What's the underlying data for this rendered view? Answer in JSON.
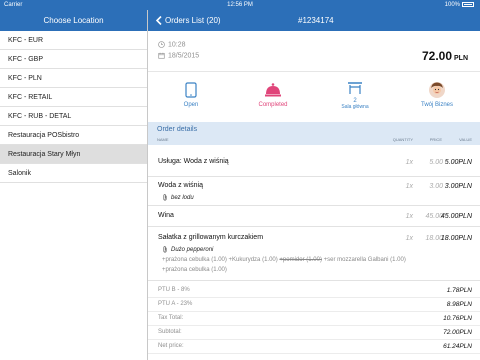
{
  "status_bar": {
    "carrier": "Carrier",
    "time": "12:56 PM",
    "battery": "100%",
    "battery_level": 1.0
  },
  "sidebar": {
    "title": "Choose Location",
    "items": [
      {
        "label": "KFC - EUR"
      },
      {
        "label": "KFC - GBP"
      },
      {
        "label": "KFC - PLN"
      },
      {
        "label": "KFC - RETAIL"
      },
      {
        "label": "KFC - RUB - DETAL"
      },
      {
        "label": "Restauracja POSbistro"
      },
      {
        "label": "Restauracja Stary Młyn"
      },
      {
        "label": "Salonik"
      }
    ]
  },
  "header": {
    "back_label": "Orders List (20)",
    "order_number": "#1234174"
  },
  "order": {
    "time": "10:28",
    "date": "18/5/2015",
    "total": "72.00",
    "currency": "PLN"
  },
  "statuses": [
    {
      "label": "Open",
      "icon": "tablet-icon"
    },
    {
      "label": "Completed",
      "icon": "service-bell-icon"
    },
    {
      "label": "Sala główna",
      "badge": "2",
      "icon": "table-icon"
    },
    {
      "label": "Twój Biznes",
      "icon": "person-avatar-icon"
    }
  ],
  "details": {
    "title": "Order details",
    "col_name": "NAME",
    "col_quantity": "QUANTITY",
    "col_price": "PRICE",
    "col_value": "VALUE"
  },
  "items": [
    {
      "name": "Usługa: Woda z wiśnią",
      "qty": "1x",
      "price": "5.00",
      "value": "5.00PLN"
    },
    {
      "name": "Woda z wiśnią",
      "qty": "1x",
      "price": "3.00",
      "value": "3.00PLN",
      "note": "bez lodu"
    },
    {
      "name": "Wina",
      "qty": "1x",
      "price": "45.00",
      "value": "45.00PLN"
    },
    {
      "name": "Sałatka z grillowanym kurczakiem",
      "qty": "1x",
      "price": "18.00",
      "value": "18.00PLN",
      "note": "Dużo pepperoni",
      "mods_line1_a": "+prażona cebulka (1.00)",
      "mods_line1_b": "+Kukurydza (1.00)",
      "mods_line1_c": "+pomidor (1.00)",
      "mods_line1_d": "+ser mozzarella Galbani (1.00)",
      "mods_line2": "+prażona cebulka (1.00)"
    }
  ],
  "totals": [
    {
      "label": "PTU B - 8%",
      "value": "1.78PLN"
    },
    {
      "label": "PTU A - 23%",
      "value": "8.98PLN"
    },
    {
      "label": "Tax Total:",
      "value": "10.76PLN"
    },
    {
      "label": "Subtotal:",
      "value": "72.00PLN"
    },
    {
      "label": "Net price:",
      "value": "61.24PLN"
    }
  ],
  "colors": {
    "header": "#2c6fb8",
    "accent": "#3b82c4",
    "selected_row": "#dedede",
    "details_bar": "#dce8f5"
  }
}
